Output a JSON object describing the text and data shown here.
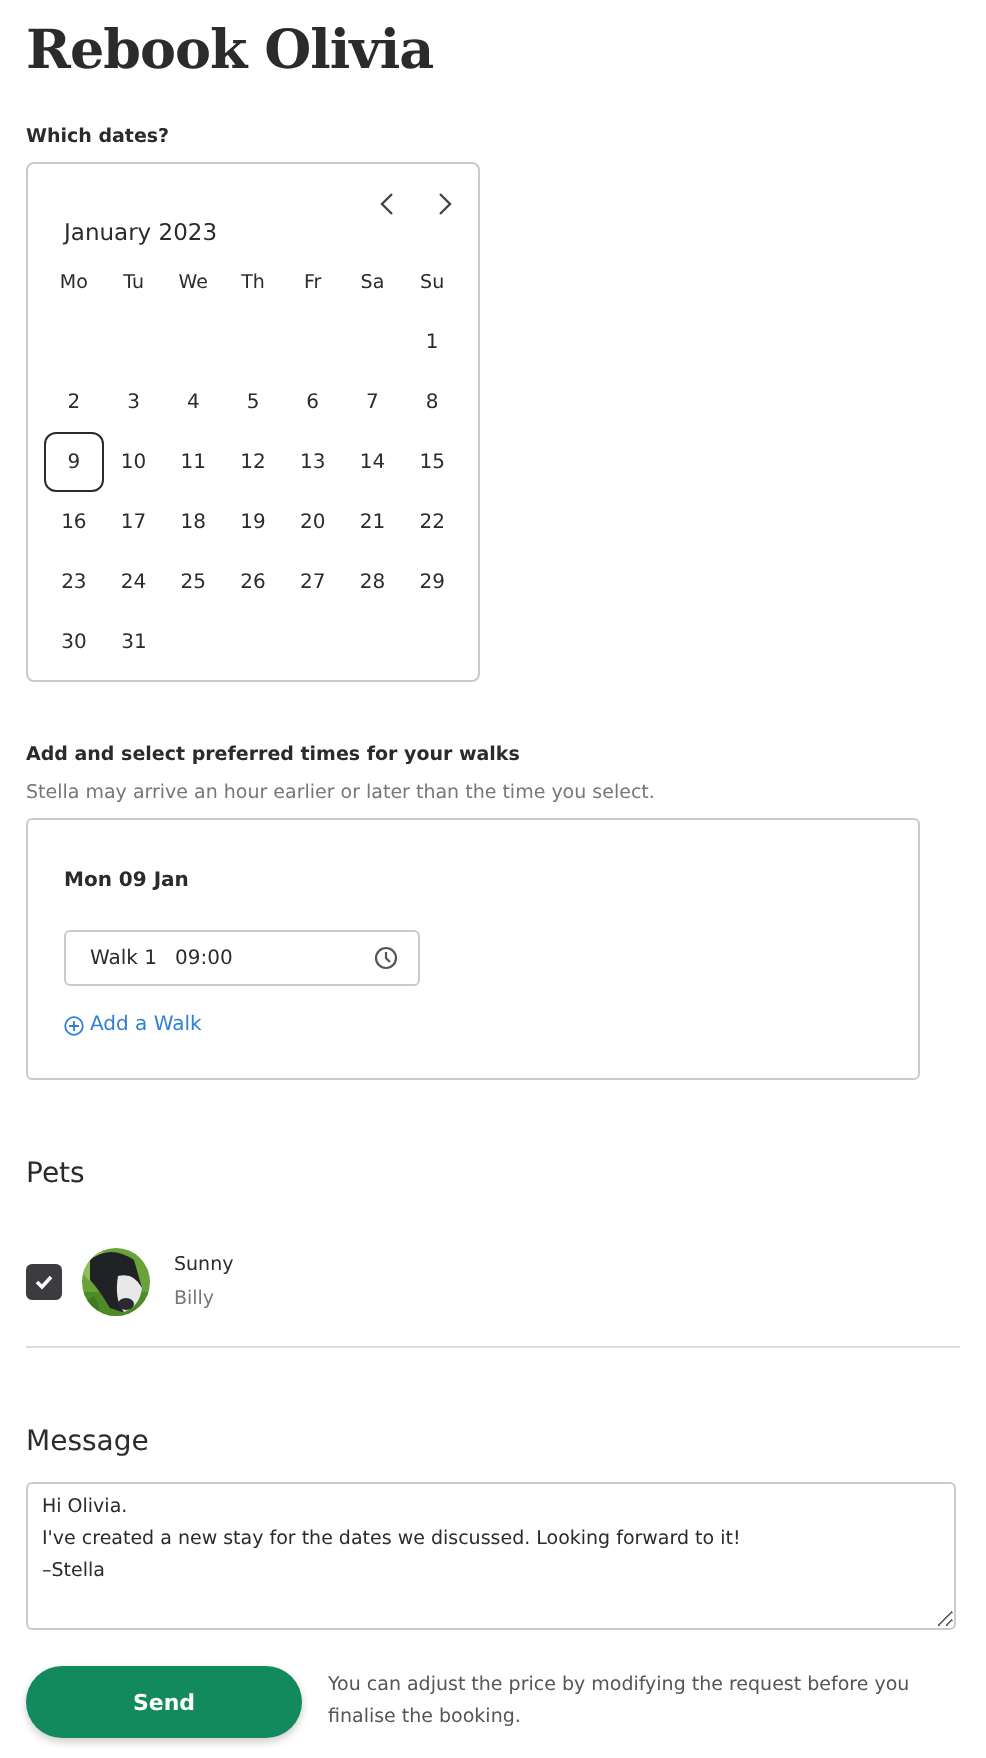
{
  "title": "Rebook Olivia",
  "dates": {
    "label": "Which dates?",
    "calendar": {
      "month": "January 2023",
      "weekdays": [
        "Mo",
        "Tu",
        "We",
        "Th",
        "Fr",
        "Sa",
        "Su"
      ],
      "weeks": [
        {
          "kind": "lead",
          "days": [
            {
              "label": "1",
              "selected": false
            }
          ]
        },
        {
          "kind": "full",
          "days": [
            {
              "label": "2",
              "selected": false
            },
            {
              "label": "3",
              "selected": false
            },
            {
              "label": "4",
              "selected": false
            },
            {
              "label": "5",
              "selected": false
            },
            {
              "label": "6",
              "selected": false
            },
            {
              "label": "7",
              "selected": false
            },
            {
              "label": "8",
              "selected": false
            }
          ]
        },
        {
          "kind": "full",
          "days": [
            {
              "label": "9",
              "selected": true
            },
            {
              "label": "10",
              "selected": false
            },
            {
              "label": "11",
              "selected": false
            },
            {
              "label": "12",
              "selected": false
            },
            {
              "label": "13",
              "selected": false
            },
            {
              "label": "14",
              "selected": false
            },
            {
              "label": "15",
              "selected": false
            }
          ]
        },
        {
          "kind": "full",
          "days": [
            {
              "label": "16",
              "selected": false
            },
            {
              "label": "17",
              "selected": false
            },
            {
              "label": "18",
              "selected": false
            },
            {
              "label": "19",
              "selected": false
            },
            {
              "label": "20",
              "selected": false
            },
            {
              "label": "21",
              "selected": false
            },
            {
              "label": "22",
              "selected": false
            }
          ]
        },
        {
          "kind": "full",
          "days": [
            {
              "label": "23",
              "selected": false
            },
            {
              "label": "24",
              "selected": false
            },
            {
              "label": "25",
              "selected": false
            },
            {
              "label": "26",
              "selected": false
            },
            {
              "label": "27",
              "selected": false
            },
            {
              "label": "28",
              "selected": false
            },
            {
              "label": "29",
              "selected": false
            }
          ]
        },
        {
          "kind": "full",
          "days": [
            {
              "label": "30",
              "selected": false
            },
            {
              "label": "31",
              "selected": false
            }
          ]
        }
      ]
    }
  },
  "times": {
    "label": "Add and select preferred times for your walks",
    "hint": "Stella may arrive an hour earlier or later than the time you select.",
    "days": [
      {
        "date": "Mon 09 Jan",
        "walks": [
          {
            "label": "Walk 1",
            "value": "09:00"
          }
        ],
        "add_label": "Add a Walk"
      }
    ]
  },
  "pets": {
    "heading": "Pets",
    "items": [
      {
        "name": "Sunny",
        "owner": "Billy",
        "checked": true
      }
    ]
  },
  "message": {
    "heading": "Message",
    "value": "Hi Olivia.\nI've created a new stay for the dates we discussed. Looking forward to it!\n–Stella"
  },
  "send": {
    "label": "Send",
    "note": "You can adjust the price by modifying the request before you finalise the booking."
  }
}
